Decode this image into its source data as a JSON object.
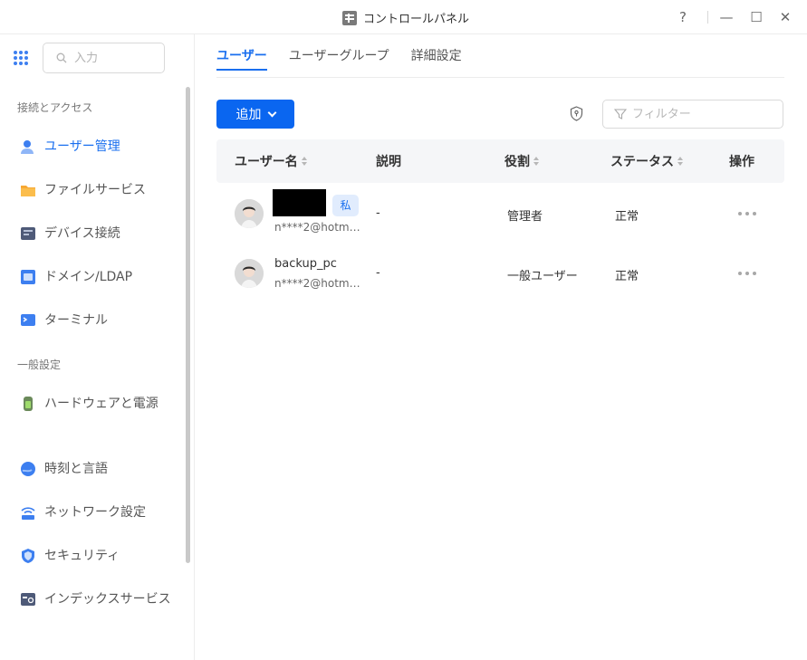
{
  "window": {
    "title": "コントロールパネル",
    "controls": {
      "help": "?",
      "minimize": "—",
      "maximize": "☐",
      "close": "✕"
    }
  },
  "sidebar": {
    "search_placeholder": "入力",
    "sections": [
      {
        "label": "接続とアクセス",
        "items": [
          {
            "label": "ユーザー管理",
            "icon": "user-icon",
            "active": true
          },
          {
            "label": "ファイルサービス",
            "icon": "folder-icon"
          },
          {
            "label": "デバイス接続",
            "icon": "device-icon"
          },
          {
            "label": "ドメイン/LDAP",
            "icon": "domain-icon"
          },
          {
            "label": "ターミナル",
            "icon": "terminal-icon"
          }
        ]
      },
      {
        "label": "一般設定",
        "items": [
          {
            "label": "ハードウェアと電源",
            "icon": "hardware-icon"
          },
          {
            "label": "時刻と言語",
            "icon": "globe-icon"
          },
          {
            "label": "ネットワーク設定",
            "icon": "network-icon"
          },
          {
            "label": "セキュリティ",
            "icon": "shield-icon"
          },
          {
            "label": "インデックスサービス",
            "icon": "index-icon"
          }
        ]
      }
    ]
  },
  "tabs": [
    {
      "label": "ユーザー",
      "active": true
    },
    {
      "label": "ユーザーグループ"
    },
    {
      "label": "詳細設定"
    }
  ],
  "toolbar": {
    "add_label": "追加",
    "filter_placeholder": "フィルター"
  },
  "table": {
    "headers": {
      "username": "ユーザー名",
      "description": "説明",
      "role": "役割",
      "status": "ステータス",
      "actions": "操作"
    },
    "rows": [
      {
        "name": "",
        "badge": "私",
        "email": "n****2@hotmail.com",
        "description": "-",
        "role": "管理者",
        "status": "正常"
      },
      {
        "name": "backup_pc",
        "email": "n****2@hotmail.com",
        "description": "-",
        "role": "一般ユーザー",
        "status": "正常"
      }
    ]
  },
  "colors": {
    "accent": "#1a6fef",
    "button": "#0a66f0"
  }
}
